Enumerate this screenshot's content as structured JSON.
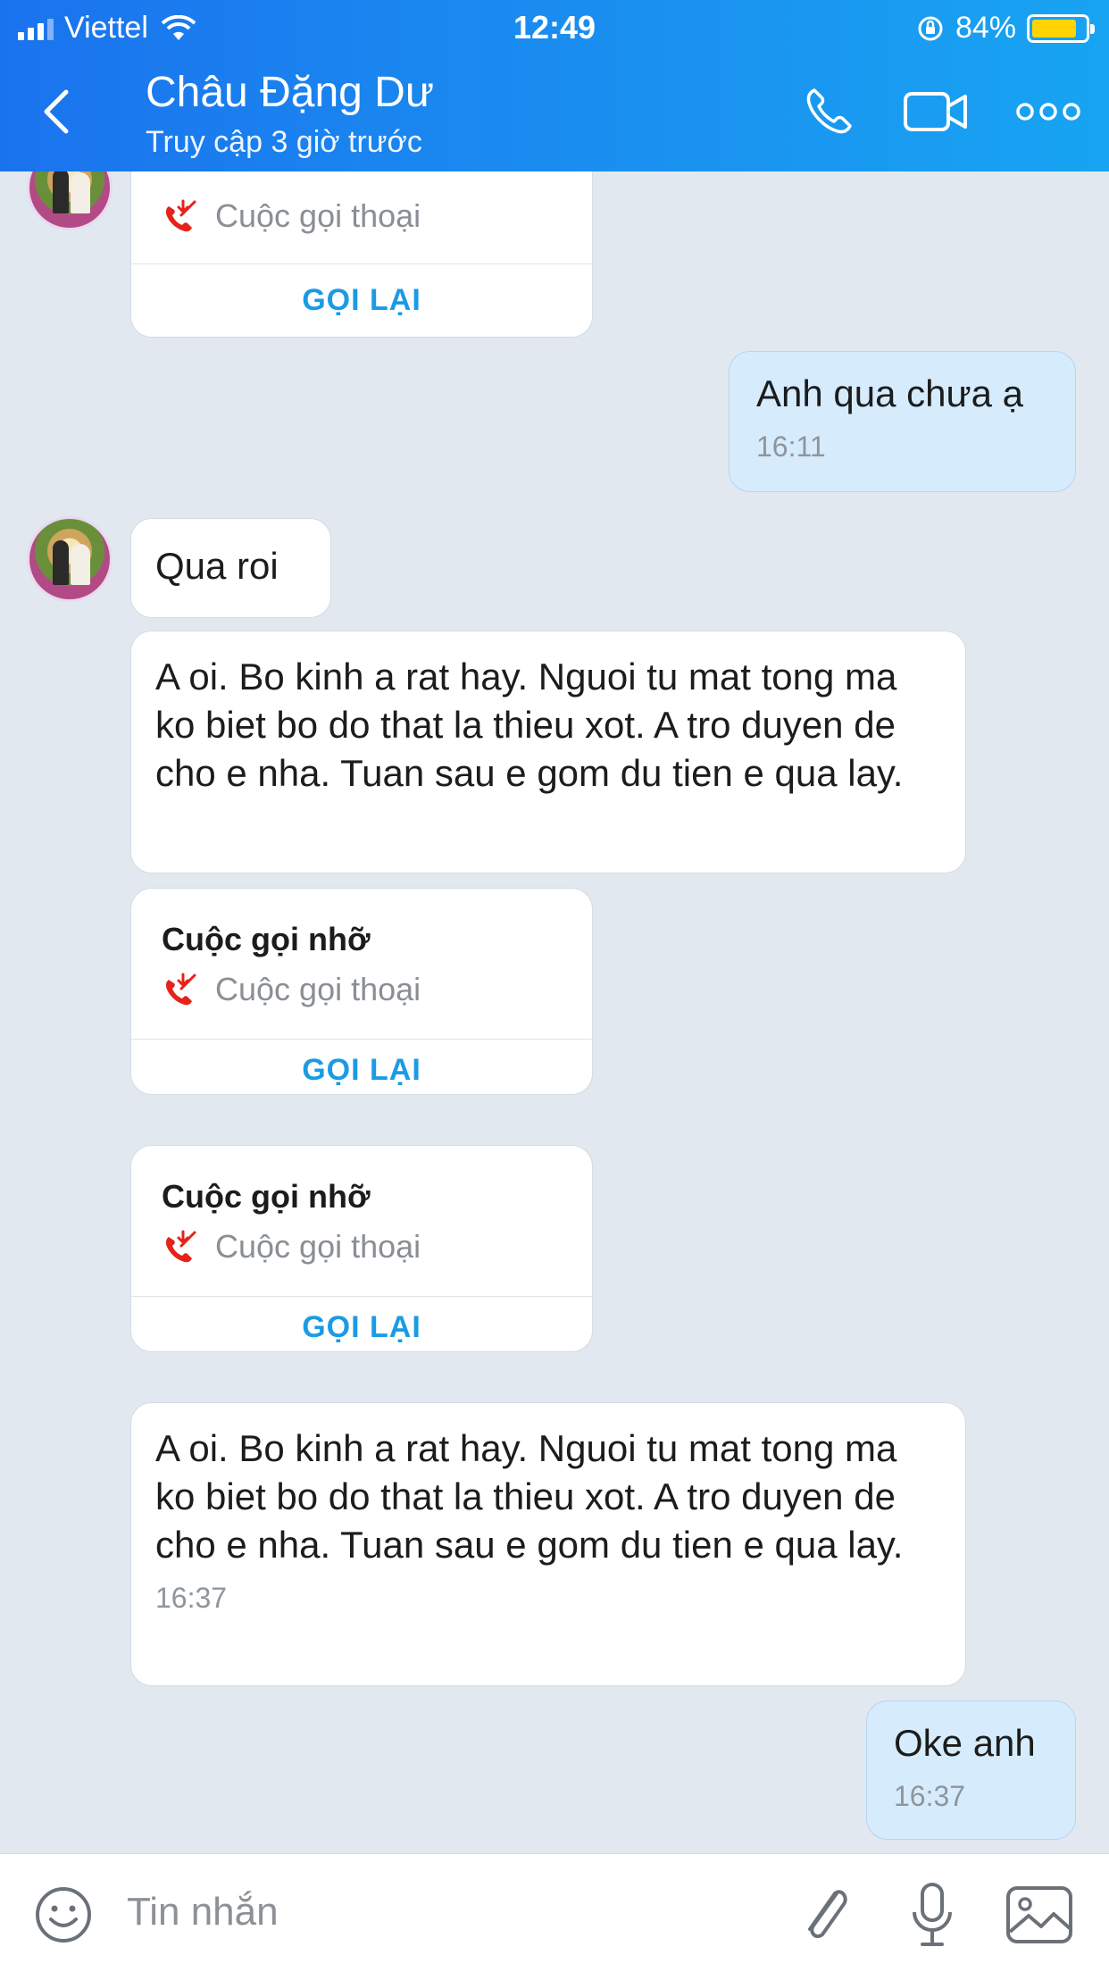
{
  "status_bar": {
    "carrier": "Viettel",
    "time": "12:49",
    "battery": "84%",
    "battery_level": 0.84
  },
  "header": {
    "contact_name": "Châu Đặng Dư",
    "contact_status": "Truy cập 3 giờ trước",
    "icons": [
      "back-icon",
      "phone-icon",
      "video-call-icon",
      "more-icon"
    ]
  },
  "messages": {
    "call_top": {
      "subtitle": "Cuộc gọi thoại",
      "action": "GỌI LẠI"
    },
    "m1": {
      "text": "Anh qua chưa ạ",
      "time": "16:11"
    },
    "m2": {
      "text": "Qua roi"
    },
    "m3": {
      "text": "A oi. Bo kinh a rat hay. Nguoi tu mat tong ma ko biet bo do that la thieu xot. A tro duyen de cho e nha. Tuan sau e gom du tien e qua lay."
    },
    "call2": {
      "title": "Cuộc gọi nhỡ",
      "subtitle": "Cuộc gọi thoại",
      "action": "GỌI LẠI"
    },
    "call3": {
      "title": "Cuộc gọi nhỡ",
      "subtitle": "Cuộc gọi thoại",
      "action": "GỌI LẠI"
    },
    "m4": {
      "text": "A oi. Bo kinh a rat hay. Nguoi tu mat tong ma ko biet bo do that la thieu xot. A tro duyen de cho e nha. Tuan sau e gom du tien e qua lay.",
      "time": "16:37"
    },
    "m5": {
      "text": "Oke anh",
      "time": "16:37"
    }
  },
  "input": {
    "placeholder": "Tin nhắn",
    "icons": [
      "emoji-icon",
      "attach-icon",
      "mic-icon",
      "image-icon"
    ]
  },
  "colors": {
    "header_start": "#1a73ee",
    "header_end": "#18a4f2",
    "background": "#e2e8ef",
    "own_bubble": "#d6ecfd",
    "missed_call_red": "#e5231b",
    "callback_blue": "#1a9be6"
  }
}
